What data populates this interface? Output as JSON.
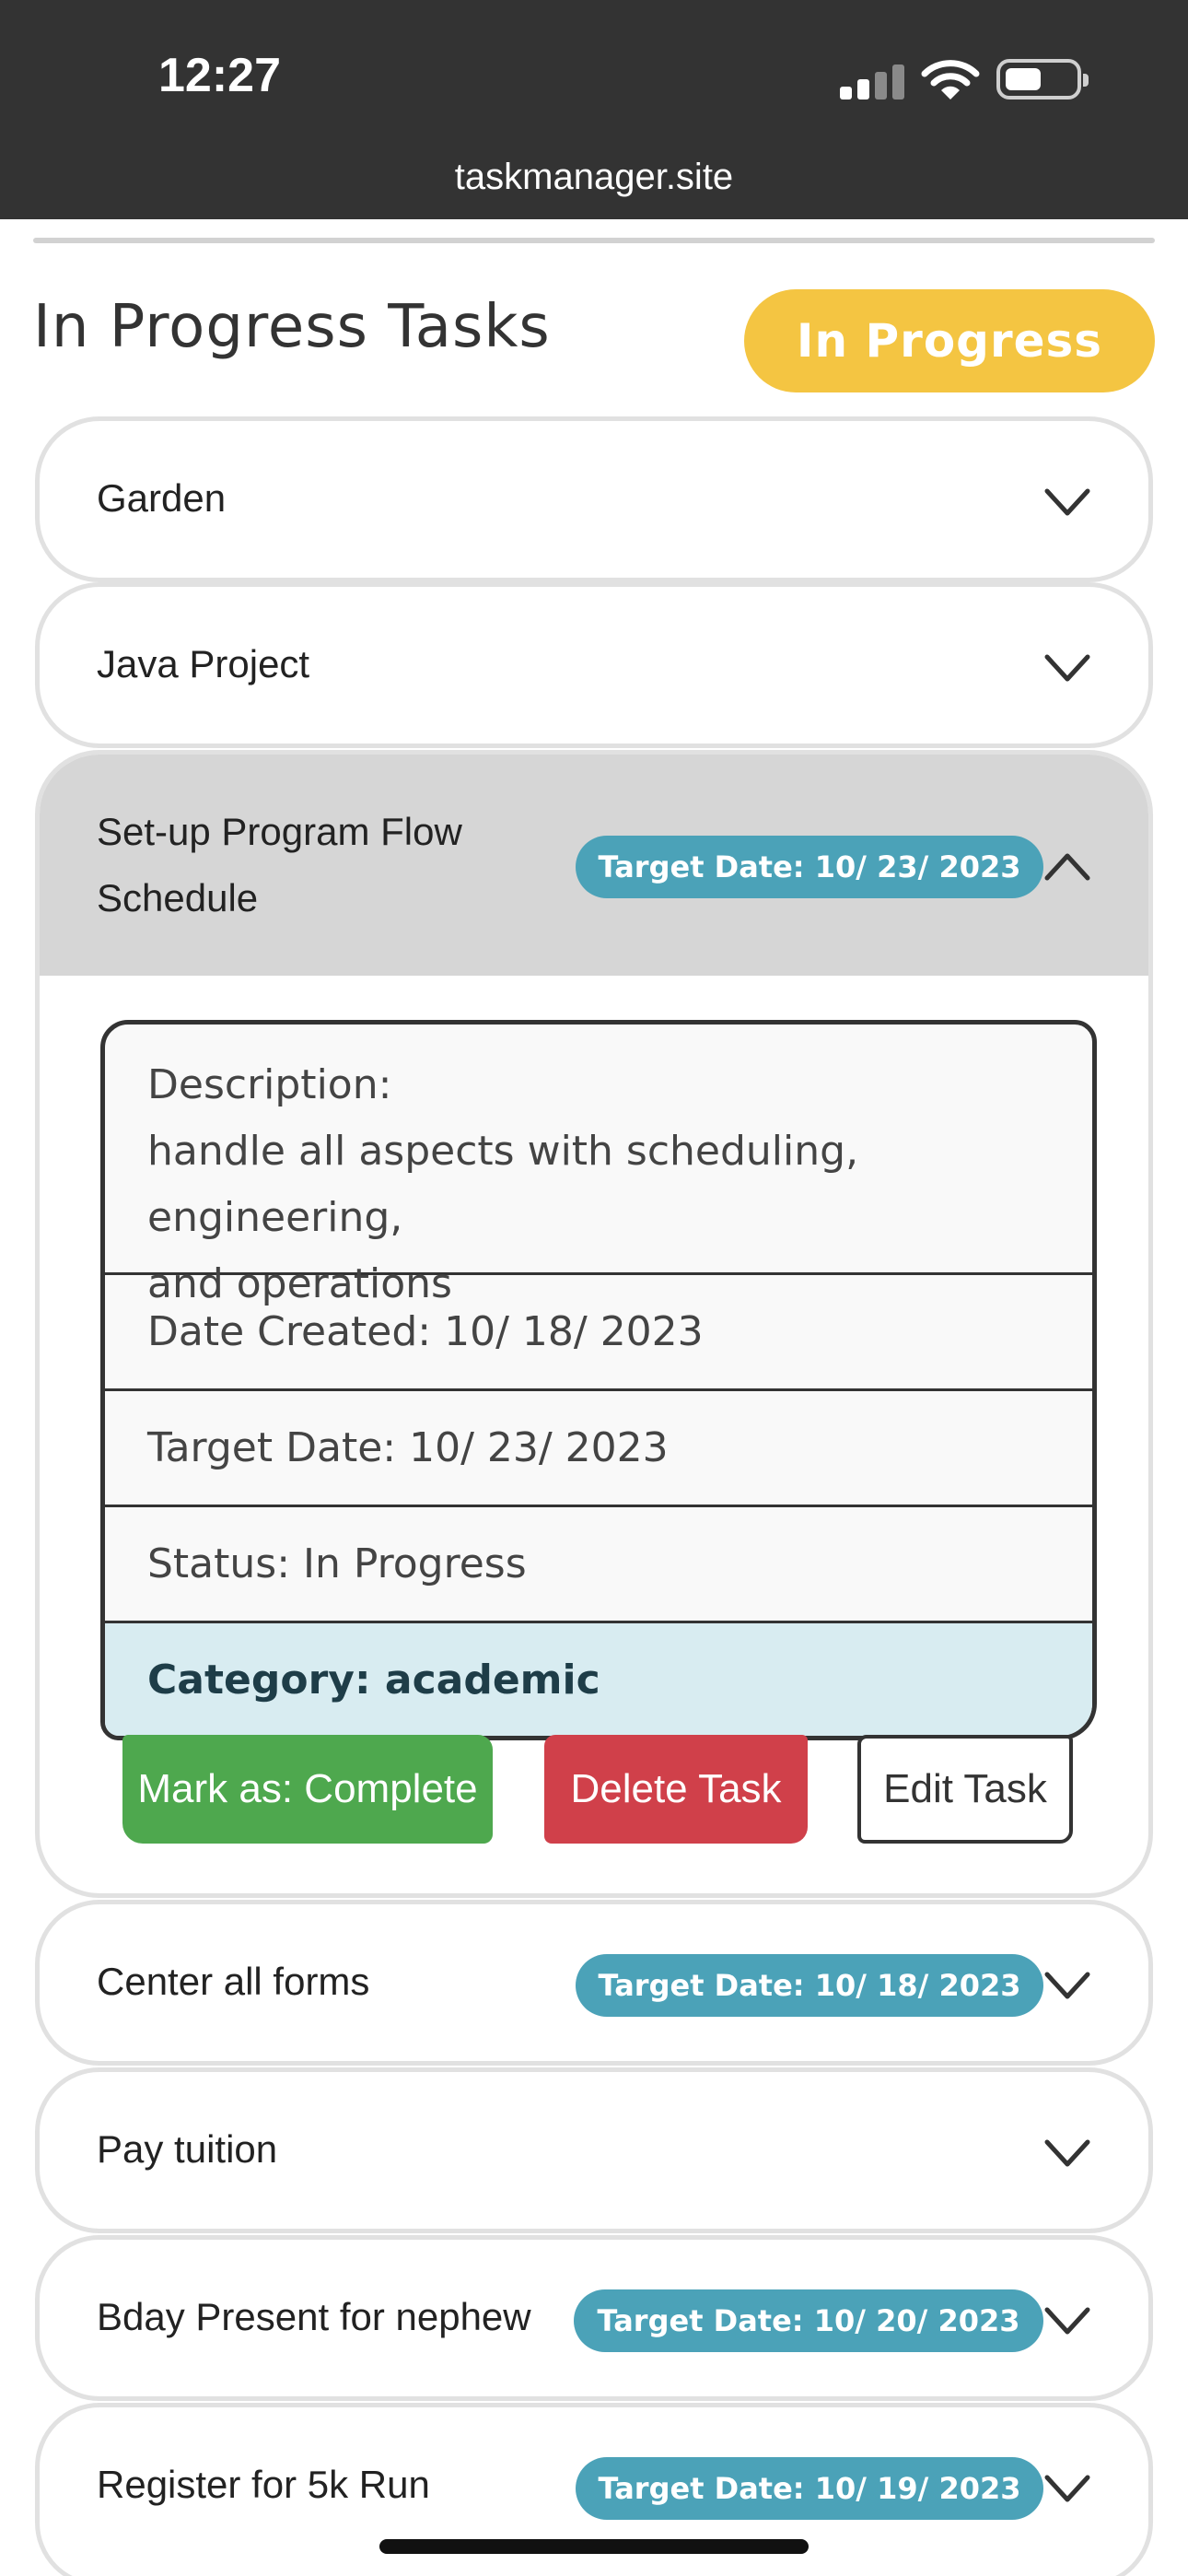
{
  "status_bar": {
    "time": "12:27"
  },
  "browser": {
    "url": "taskmanager.site"
  },
  "page": {
    "title": "In Progress Tasks",
    "status_filter": "In Progress"
  },
  "tasks": [
    {
      "name": "Garden",
      "target_date": ""
    },
    {
      "name": "Java Project",
      "target_date": ""
    },
    {
      "name_line1": "Set-up Program Flow",
      "name_line2": "Schedule",
      "target_date": "Target Date: 10/ 23/ 2023",
      "expanded": true,
      "details": {
        "description_label": "Description:",
        "description_line1": "handle all aspects with scheduling, engineering,",
        "description_line2": "and operations",
        "date_created": "Date Created: 10/ 18/ 2023",
        "target_date": "Target Date: 10/ 23/ 2023",
        "status": "Status: In Progress",
        "category": "Category: academic"
      },
      "actions": {
        "complete": "Mark as: Complete",
        "delete": "Delete Task",
        "edit": "Edit Task"
      }
    },
    {
      "name": "Center all forms",
      "target_date": "Target Date: 10/ 18/ 2023"
    },
    {
      "name": "Pay tuition",
      "target_date": ""
    },
    {
      "name": "Bday Present for nephew",
      "target_date": "Target Date: 10/ 20/ 2023"
    },
    {
      "name": "Register for 5k Run",
      "target_date": "Target Date: 10/ 19/ 2023"
    }
  ],
  "colors": {
    "status_pill": "#f4c542",
    "date_pill": "#4ba2b8",
    "complete_button": "#4ea84e",
    "delete_button": "#d0404a",
    "category_row": "#d8ecf1"
  }
}
